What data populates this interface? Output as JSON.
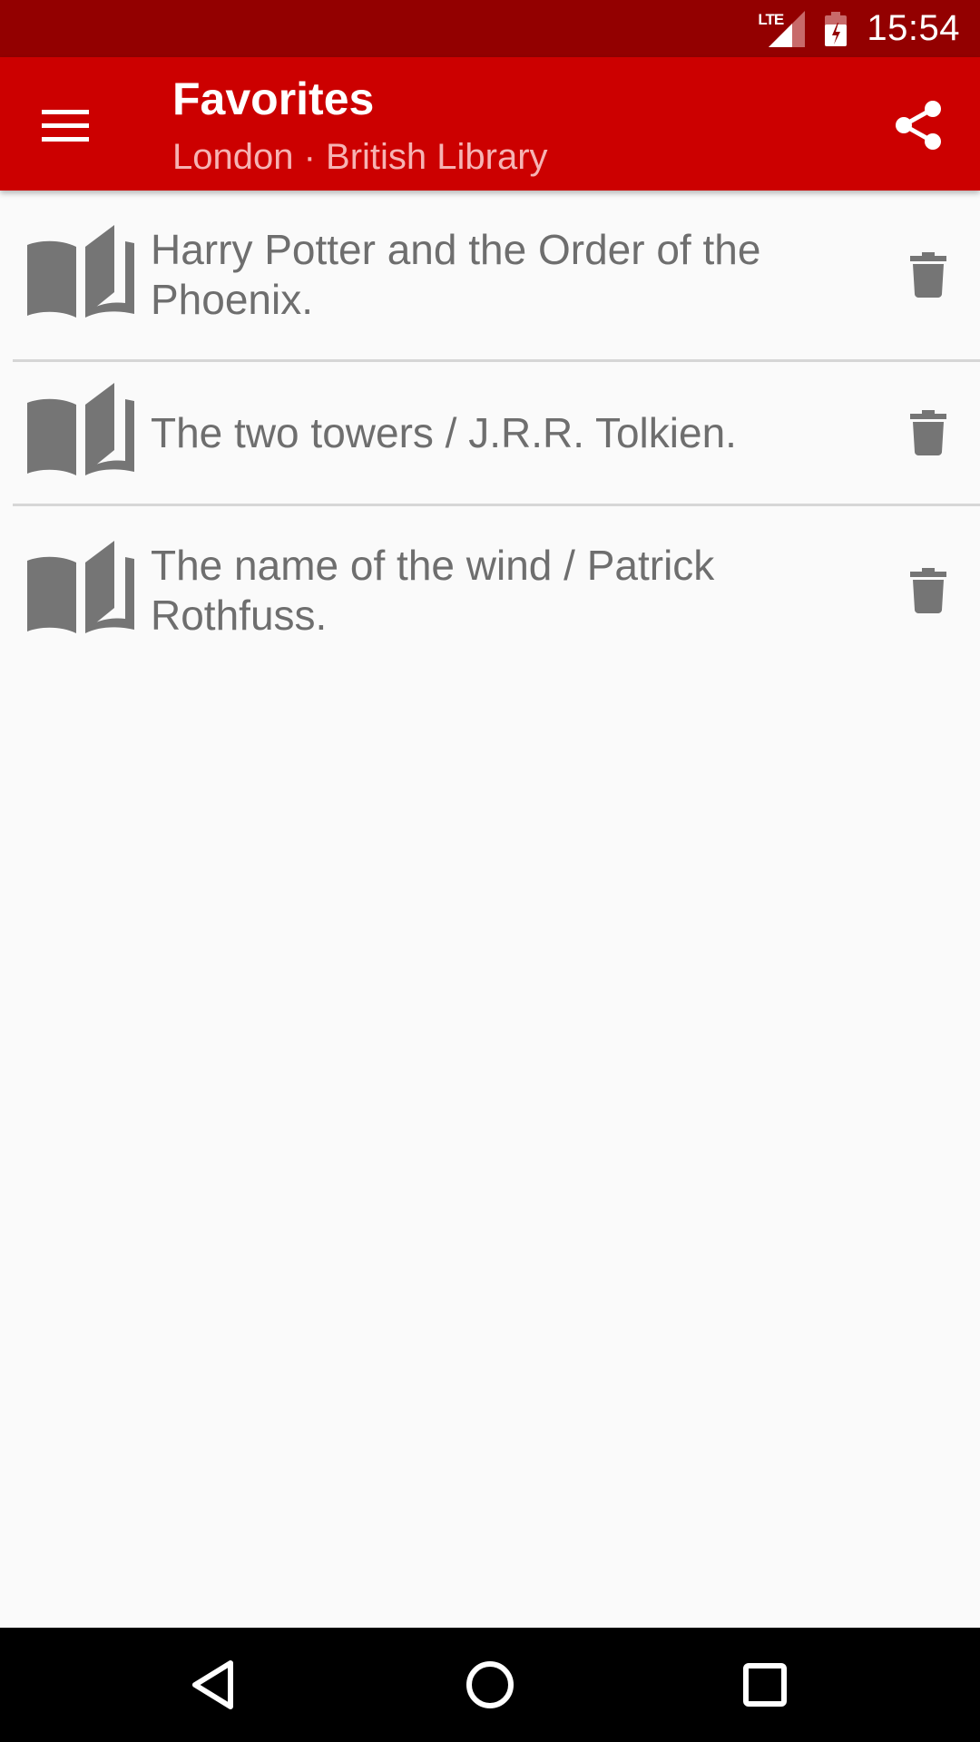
{
  "status_bar": {
    "network_label": "LTE",
    "time": "15:54"
  },
  "app_bar": {
    "title": "Favorites",
    "subtitle": "London · British Library",
    "menu_icon": "hamburger-menu-icon",
    "share_icon": "share-icon",
    "background_color": "#cc0000",
    "status_color": "#930000"
  },
  "favorites": [
    {
      "title": "Harry Potter and the Order of the Phoenix.",
      "icon": "book-icon",
      "action_icon": "trash-icon"
    },
    {
      "title": "The two towers / J.R.R. Tolkien.",
      "icon": "book-icon",
      "action_icon": "trash-icon"
    },
    {
      "title": "The name of the wind / Patrick Rothfuss.",
      "icon": "book-icon",
      "action_icon": "trash-icon"
    }
  ],
  "nav_bar": {
    "back_icon": "back-triangle-icon",
    "home_icon": "home-circle-icon",
    "recents_icon": "recents-square-icon"
  }
}
